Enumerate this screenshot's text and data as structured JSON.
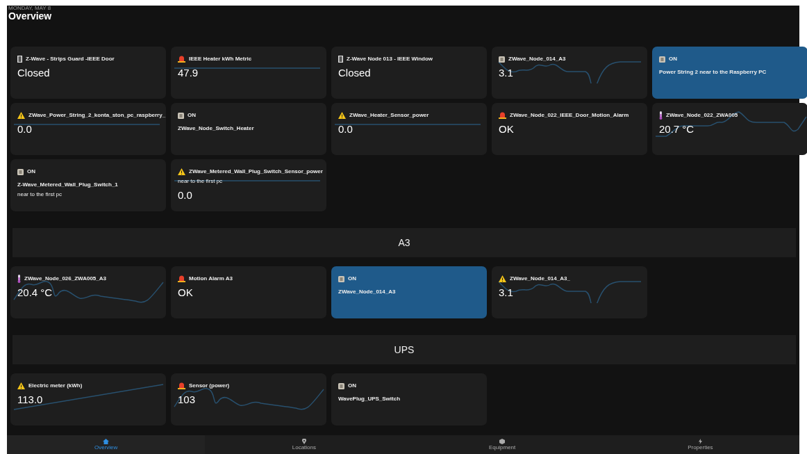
{
  "header": {
    "date": "MONDAY, MAY 8",
    "title": "Overview"
  },
  "sections": [
    {
      "cards": [
        {
          "kind": "door",
          "title": "Z-Wave - Strips Guard -IEEE Door",
          "value": "Closed",
          "highlighted": false
        },
        {
          "kind": "alarm",
          "title": "IEEE Heater kWh Metric",
          "value": "47.9",
          "highlighted": false
        },
        {
          "kind": "door",
          "title": "Z-Wave Node 013 - IEEE Window",
          "value": "Closed",
          "highlighted": false
        },
        {
          "kind": "switch",
          "title": "ZWave_Node_014_A3",
          "value": "3.1",
          "highlighted": false
        },
        {
          "kind": "switch",
          "title": "ON",
          "name": "Power String 2 near to the Raspberry PC",
          "highlighted": true
        },
        {
          "kind": "warning",
          "title": "ZWave_Power_String_2_konta_ston_pc_raspberry_",
          "value": "0.0",
          "highlighted": false
        },
        {
          "kind": "switch",
          "title": "ON",
          "name": "ZWave_Node_Switch_Heater",
          "highlighted": false
        },
        {
          "kind": "warning",
          "title": "ZWave_Heater_Sensor_power",
          "value": "0.0",
          "highlighted": false
        },
        {
          "kind": "alarm",
          "title": "ZWave_Node_022_IEEE_Door_Motion_Alarm",
          "value": "OK",
          "highlighted": false
        },
        {
          "kind": "thermometer",
          "title": "ZWave_Node_022_ZWA005",
          "value": "20.7 °C",
          "highlighted": false
        },
        {
          "kind": "switch",
          "title": "ON",
          "name": "Z-Wave_Metered_Wall_Plug_Switch_1",
          "subtitle": "near to the first pc",
          "highlighted": false
        },
        {
          "kind": "warning",
          "title": "ZWave_Metered_Wall_Plug_Switch_Sensor_power",
          "subtitle": "near to the first pc",
          "value": "0.0",
          "highlighted": false
        }
      ]
    },
    {
      "heading": "A3",
      "cards": [
        {
          "kind": "thermometer",
          "title": "ZWave_Node_026_ZWA005_A3",
          "value": "20.4 °C",
          "highlighted": false
        },
        {
          "kind": "alarm",
          "title": "Motion Alarm A3",
          "value": "OK",
          "highlighted": false
        },
        {
          "kind": "switch",
          "title": "ON",
          "name": "ZWave_Node_014_A3",
          "highlighted": true
        },
        {
          "kind": "warning",
          "title": "ZWave_Node_014_A3_",
          "value": "3.1",
          "highlighted": false
        }
      ]
    },
    {
      "heading": "UPS",
      "cards": [
        {
          "kind": "warning",
          "title": "Electric meter (kWh)",
          "value": "113.0",
          "highlighted": false
        },
        {
          "kind": "alarm",
          "title": "Sensor (power)",
          "value": "103",
          "highlighted": false
        },
        {
          "kind": "switch",
          "title": "ON",
          "name": "WavePlug_UPS_Switch",
          "highlighted": false
        }
      ]
    }
  ],
  "nav": [
    {
      "kind": "home",
      "label": "Overview",
      "selected": true
    },
    {
      "kind": "pin",
      "label": "Locations",
      "selected": false
    },
    {
      "kind": "cube",
      "label": "Equipment",
      "selected": false
    },
    {
      "kind": "bolt",
      "label": "Properties",
      "selected": false
    }
  ]
}
